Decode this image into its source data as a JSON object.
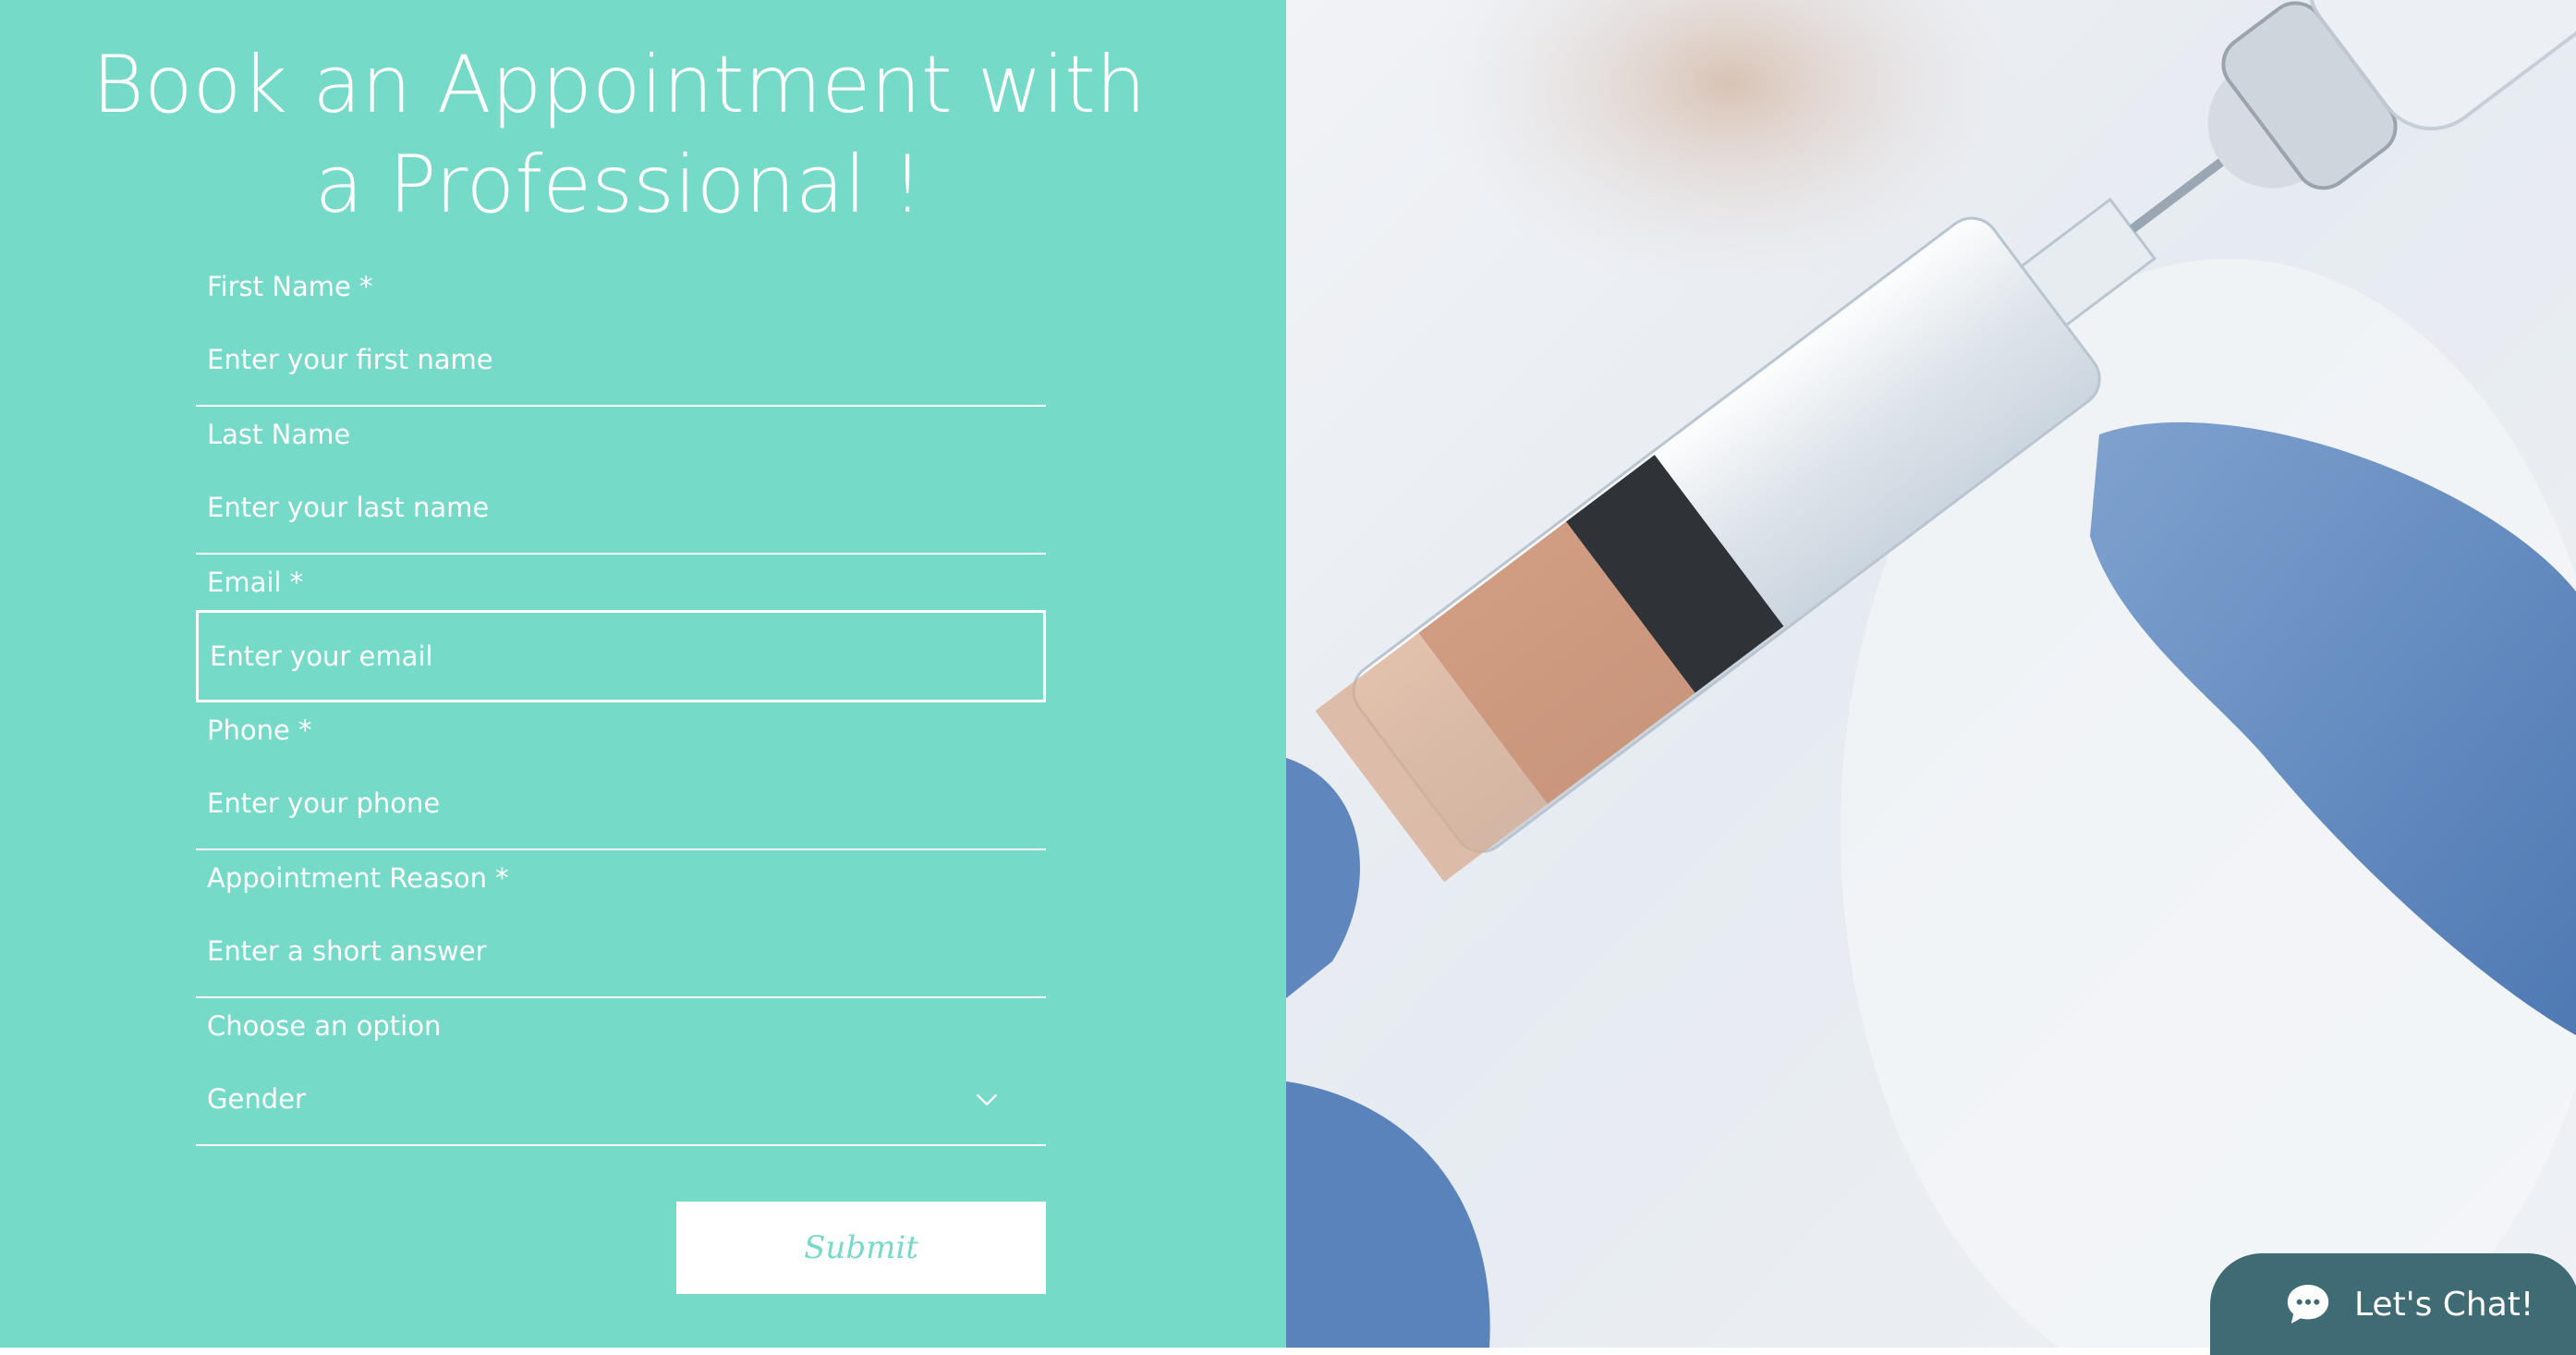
{
  "form": {
    "title_line1": "Book an Appointment with",
    "title_line2": "a Professional !",
    "fields": [
      {
        "label": "First Name *",
        "placeholder": "Enter your first name"
      },
      {
        "label": "Last Name",
        "placeholder": "Enter your last name"
      },
      {
        "label": "Email *",
        "placeholder": "Enter your email"
      },
      {
        "label": "Phone *",
        "placeholder": "Enter your phone"
      },
      {
        "label": "Appointment Reason *",
        "placeholder": "Enter a short answer"
      }
    ],
    "select": {
      "label": "Choose an option",
      "value": "Gender"
    },
    "submit_label": "Submit"
  },
  "chat": {
    "label": "Let's Chat!"
  },
  "colors": {
    "teal": "#76dac9",
    "white": "#ffffff",
    "chat_bg": "#3f6b74"
  }
}
